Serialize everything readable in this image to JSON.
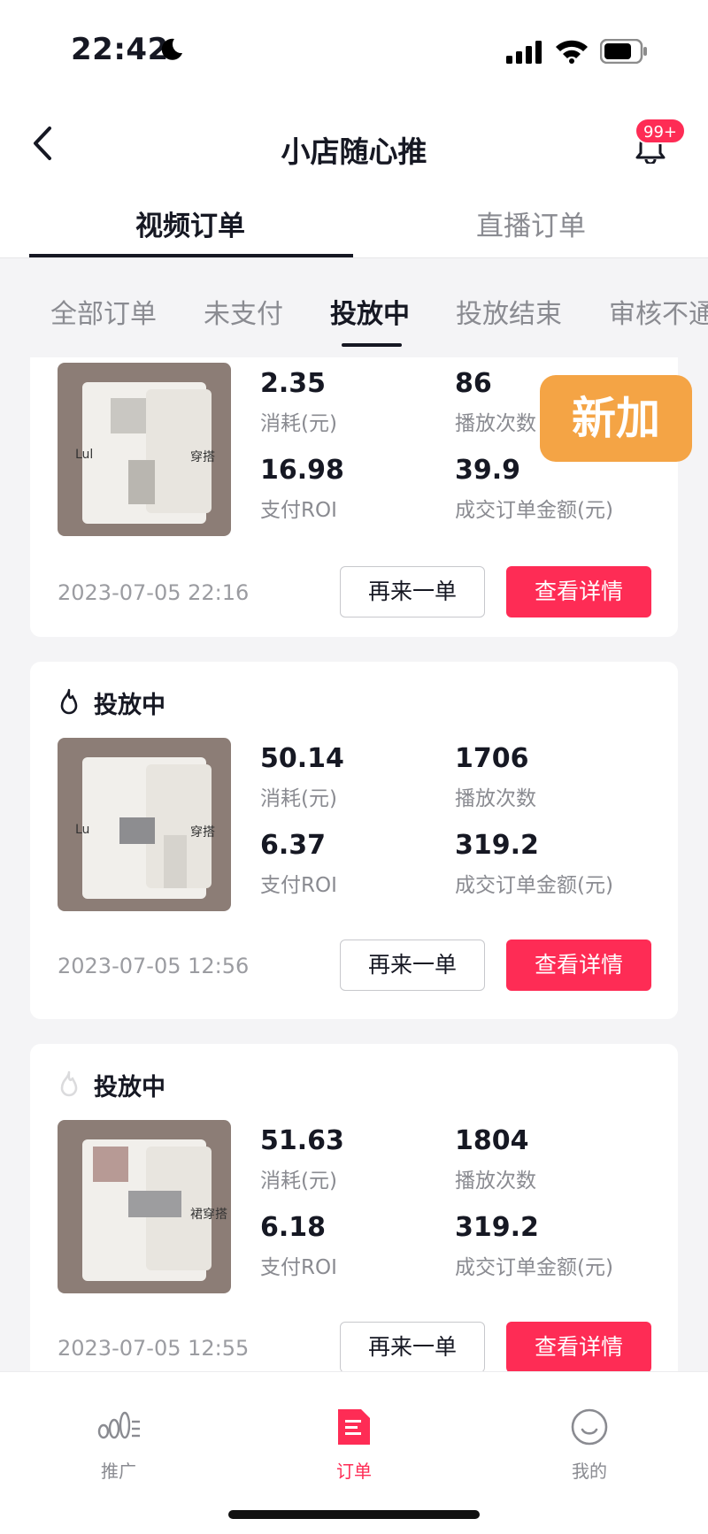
{
  "status_bar": {
    "time": "22:42"
  },
  "nav": {
    "title": "小店随心推",
    "badge": "99+"
  },
  "main_tabs": [
    {
      "label": "视频订单",
      "active": true
    },
    {
      "label": "直播订单",
      "active": false
    }
  ],
  "sub_tabs": [
    {
      "label": "全部订单",
      "active": false
    },
    {
      "label": "未支付",
      "active": false
    },
    {
      "label": "投放中",
      "active": true
    },
    {
      "label": "投放结束",
      "active": false
    },
    {
      "label": "审核不通",
      "active": false
    }
  ],
  "overlay_tag": "新加",
  "orders": [
    {
      "status": "",
      "thumb_label_left": "Lul",
      "thumb_label_right": "穿搭",
      "spend": "2.35",
      "spend_label": "消耗(元)",
      "plays": "86",
      "plays_label": "播放次数",
      "roi": "16.98",
      "roi_label": "支付ROI",
      "amount": "39.9",
      "amount_label": "成交订单金额(元)",
      "date": "2023-07-05 22:16",
      "reorder_label": "再来一单",
      "detail_label": "查看详情"
    },
    {
      "status": "投放中",
      "thumb_label_left": "Lu",
      "thumb_label_right": "穿搭",
      "spend": "50.14",
      "spend_label": "消耗(元)",
      "plays": "1706",
      "plays_label": "播放次数",
      "roi": "6.37",
      "roi_label": "支付ROI",
      "amount": "319.2",
      "amount_label": "成交订单金额(元)",
      "date": "2023-07-05 12:56",
      "reorder_label": "再来一单",
      "detail_label": "查看详情"
    },
    {
      "status": "投放中",
      "thumb_label_left": "",
      "thumb_label_right": "裙穿搭",
      "spend": "51.63",
      "spend_label": "消耗(元)",
      "plays": "1804",
      "plays_label": "播放次数",
      "roi": "6.18",
      "roi_label": "支付ROI",
      "amount": "319.2",
      "amount_label": "成交订单金额(元)",
      "date": "2023-07-05 12:55",
      "reorder_label": "再来一单",
      "detail_label": "查看详情"
    }
  ],
  "bottom_nav": [
    {
      "label": "推广",
      "icon": "promotion-icon",
      "active": false
    },
    {
      "label": "订单",
      "icon": "order-icon",
      "active": true
    },
    {
      "label": "我的",
      "icon": "smile-icon",
      "active": false
    }
  ],
  "colors": {
    "accent": "#fe2c55",
    "tag": "#f4a445",
    "text": "#161823",
    "muted": "#8a8b91"
  }
}
